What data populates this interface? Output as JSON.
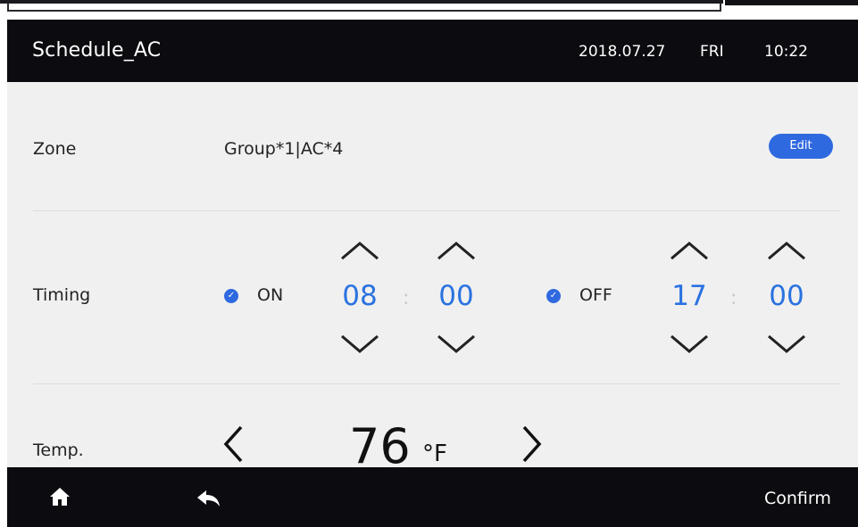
{
  "header": {
    "title": "Schedule_AC",
    "date": "2018.07.27",
    "day": "FRI",
    "time": "10:22"
  },
  "zone": {
    "label": "Zone",
    "value": "Group*1|AC*4",
    "edit_label": "Edit"
  },
  "timing": {
    "label": "Timing",
    "on": {
      "label": "ON",
      "checked": true,
      "hour": "08",
      "minute": "00"
    },
    "off": {
      "label": "OFF",
      "checked": true,
      "hour": "17",
      "minute": "00"
    },
    "separator": ":"
  },
  "temp": {
    "label": "Temp.",
    "value": "76",
    "unit": "°F"
  },
  "footer": {
    "home_icon": "home-icon",
    "back_icon": "back-arrow-icon",
    "confirm_label": "Confirm"
  },
  "colors": {
    "accent": "#2f69e0",
    "number_blue": "#2a72e0",
    "header_bg": "#0b0b10",
    "content_bg": "#f0f0f0"
  }
}
